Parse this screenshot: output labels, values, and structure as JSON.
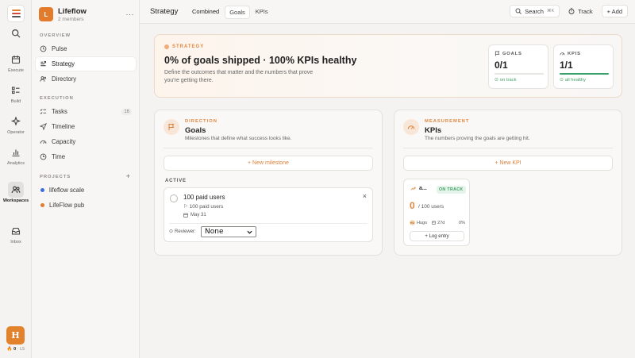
{
  "rail": {
    "items": [
      {
        "label": ""
      },
      {
        "label": "Execute"
      },
      {
        "label": "Build"
      },
      {
        "label": "Operator"
      },
      {
        "label": "Analytics"
      },
      {
        "label": "Workspaces"
      },
      {
        "label": "Inbox"
      }
    ],
    "avatar": "H",
    "streak_count": "0",
    "streak_level": "· L5"
  },
  "workspace": {
    "badge": "L",
    "name": "Lifeflow",
    "members": "2 members",
    "more": "···"
  },
  "sidebar": {
    "overview_label": "OVERVIEW",
    "overview": [
      {
        "label": "Pulse"
      },
      {
        "label": "Strategy"
      },
      {
        "label": "Directory"
      }
    ],
    "execution_label": "EXECUTION",
    "execution": [
      {
        "label": "Tasks",
        "count": "16"
      },
      {
        "label": "Timeline"
      },
      {
        "label": "Capacity"
      },
      {
        "label": "Time"
      }
    ],
    "projects_label": "PROJECTS",
    "projects_add": "+",
    "projects": [
      {
        "label": "lifeflow scale",
        "color": "#3b6fe0"
      },
      {
        "label": "LifeFlow pub",
        "color": "#e37b2d"
      }
    ]
  },
  "topbar": {
    "title": "Strategy",
    "tabs": [
      "Combined",
      "Goals",
      "KPIs"
    ],
    "search": "Search",
    "search_kbd": "⌘K",
    "track": "Track",
    "add": "+ Add"
  },
  "hero": {
    "kicker": "STRATEGY",
    "title": "0% of goals shipped · 100% KPIs healthy",
    "description": "Define the outcomes that matter and the numbers that prove you're getting there.",
    "goals": {
      "label": "GOALS",
      "value": "0/1",
      "status": "on track",
      "progress": 0
    },
    "kpis": {
      "label": "KPIS",
      "value": "1/1",
      "status": "all healthy",
      "progress": 1
    }
  },
  "direction": {
    "kicker": "DIRECTION",
    "title": "Goals",
    "description": "Milestones that define what success looks like.",
    "add_label": "+ New milestone",
    "active_label": "ACTIVE",
    "milestone": {
      "title": "100 paid users",
      "target": "⚐ 100 paid users",
      "date": "May 31",
      "reviewer_label": "Reviewer:",
      "reviewer_value": "None",
      "close": "×"
    }
  },
  "measurement": {
    "kicker": "MEASUREMENT",
    "title": "KPIs",
    "description": "The numbers proving the goals are getting hit.",
    "add_label": "+ New KPI",
    "kpi": {
      "name": "a...",
      "badge": "ON TRACK",
      "value": "0",
      "of": "/ 100  users",
      "owner_initials": "HU",
      "owner": "Hugo",
      "age": "27d",
      "pct": "0%",
      "log": "+ Log entry"
    }
  },
  "colors": {
    "accent": "#e0883f",
    "success": "#38a169",
    "brand": "#e37b2d"
  }
}
